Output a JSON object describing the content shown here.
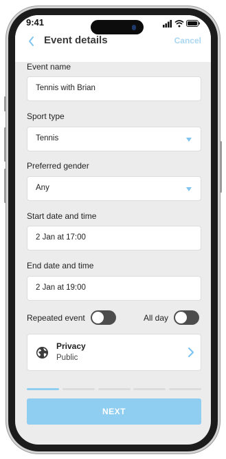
{
  "status_bar": {
    "time": "9:41"
  },
  "header": {
    "title": "Event details",
    "cancel_label": "Cancel"
  },
  "form": {
    "event_name": {
      "label": "Event name",
      "value": "Tennis with Brian"
    },
    "sport_type": {
      "label": "Sport type",
      "value": "Tennis"
    },
    "preferred_gender": {
      "label": "Preferred gender",
      "value": "Any"
    },
    "start": {
      "label": "Start date and time",
      "value": "2 Jan at 17:00"
    },
    "end": {
      "label": "End date and time",
      "value": "2 Jan at 19:00"
    },
    "repeated_event": {
      "label": "Repeated event",
      "on": false
    },
    "all_day": {
      "label": "All day",
      "on": false
    }
  },
  "privacy": {
    "title": "Privacy",
    "value": "Public",
    "icon": "globe-icon"
  },
  "progress": {
    "total_steps": 5,
    "current_step": 1
  },
  "next_label": "NEXT",
  "colors": {
    "accent": "#8fcdf1",
    "accent_text": "#a8d6f3",
    "progress_active": "#8fcdf1",
    "progress_inactive": "#dcdcdc",
    "toggle_off": "#4d4d4d"
  }
}
